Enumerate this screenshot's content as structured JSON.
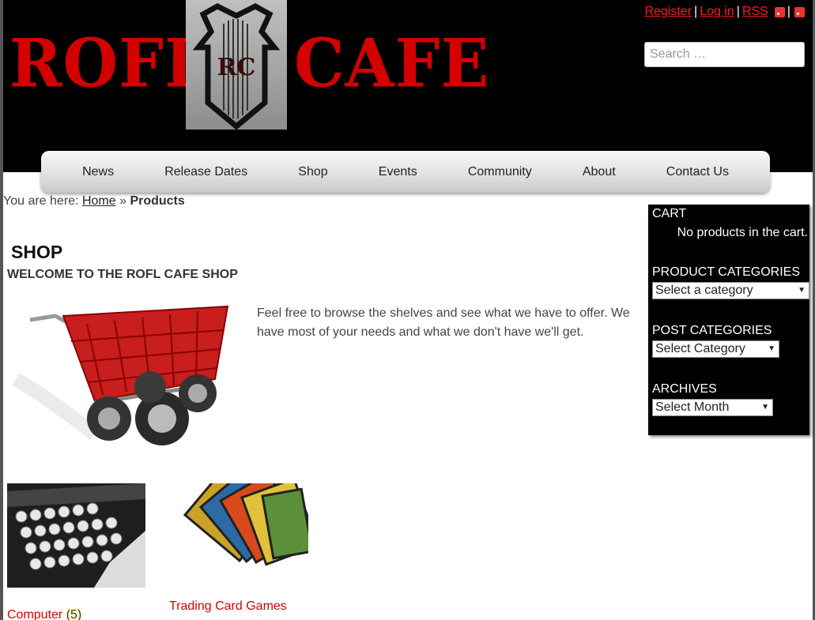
{
  "header": {
    "logo_left": "ROFL",
    "logo_right": "CAFE",
    "crest_letters": "RC",
    "links": {
      "register": "Register",
      "login": "Log in",
      "rss": "RSS"
    },
    "separator": "|",
    "search": {
      "placeholder": "Search …",
      "value": ""
    }
  },
  "nav": {
    "items": [
      {
        "label": "News"
      },
      {
        "label": "Release Dates"
      },
      {
        "label": "Shop"
      },
      {
        "label": "Events"
      },
      {
        "label": "Community"
      },
      {
        "label": "About"
      },
      {
        "label": "Contact Us"
      }
    ]
  },
  "breadcrumb": {
    "prefix": "You are here:",
    "home": "Home",
    "sep": "»",
    "current": "Products"
  },
  "main": {
    "title": "SHOP",
    "subtitle": "WELCOME TO THE ROFL CAFE SHOP",
    "intro": "Feel free to browse the shelves and see what we have to offer. We have most of your needs and what we don't have we'll get.",
    "categories": [
      {
        "name": "Computer",
        "count": "(5)"
      },
      {
        "name": "Trading Card Games",
        "count": ""
      }
    ]
  },
  "sidebar": {
    "cart": {
      "title": "CART",
      "empty": "No products in the cart."
    },
    "product_categories": {
      "title": "PRODUCT CATEGORIES",
      "selected": "Select a category"
    },
    "post_categories": {
      "title": "POST CATEGORIES",
      "selected": "Select Category"
    },
    "archives": {
      "title": "ARCHIVES",
      "selected": "Select Month"
    }
  },
  "colors": {
    "accent": "#d40000",
    "header_bg": "#000000",
    "sidebar_bg": "#000000"
  }
}
